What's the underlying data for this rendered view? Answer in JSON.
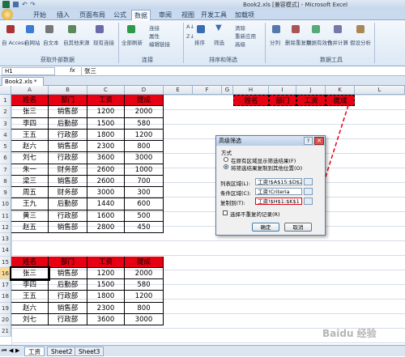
{
  "app": {
    "title": "Book2.xls [兼容模式] - Microsoft Excel"
  },
  "ribbon_tabs": [
    "开始",
    "插入",
    "页面布局",
    "公式",
    "数据",
    "审阅",
    "视图",
    "开发工具",
    "加载项"
  ],
  "ribbon": {
    "get_external": {
      "items": [
        "自 Access",
        "自网站",
        "自文本",
        "自其他来源",
        "现有连接"
      ],
      "group": "获取外部数据"
    },
    "connections": {
      "items": [
        "全部刷新",
        "连接",
        "属性",
        "编辑链接"
      ],
      "group": "连接"
    },
    "sort_filter": {
      "items": [
        "排序",
        "筛选",
        "清除",
        "重新应用",
        "高级"
      ],
      "group": "排序和筛选"
    },
    "data_tools": {
      "items": [
        "分列",
        "删除重复项",
        "数据有效性",
        "合并计算",
        "假设分析"
      ],
      "group": "数据工具"
    }
  },
  "formula_bar": {
    "name_box": "H1",
    "fx": "fx",
    "content": "张三"
  },
  "file_tab": {
    "label": "Book2.xls *"
  },
  "columns": [
    "A",
    "B",
    "C",
    "D",
    "E",
    "F",
    "G",
    "H",
    "I",
    "J",
    "K",
    "L"
  ],
  "rows": [
    "1",
    "2",
    "3",
    "4",
    "5",
    "6",
    "7",
    "8",
    "9",
    "10",
    "11",
    "12",
    "13",
    "14",
    "15",
    "16",
    "17",
    "18",
    "19",
    "20",
    "21"
  ],
  "table1": {
    "headers": [
      "姓名",
      "部门",
      "工资",
      "提成"
    ],
    "rows": [
      [
        "张三",
        "销售部",
        "1200",
        "2000"
      ],
      [
        "李四",
        "后勤部",
        "1500",
        "580"
      ],
      [
        "王五",
        "行政部",
        "1800",
        "1200"
      ],
      [
        "赵六",
        "销售部",
        "2300",
        "800"
      ],
      [
        "刘七",
        "行政部",
        "3600",
        "3000"
      ],
      [
        "朱一",
        "财务部",
        "2600",
        "1000"
      ],
      [
        "梁三",
        "销售部",
        "2600",
        "700"
      ],
      [
        "周五",
        "财务部",
        "3000",
        "300"
      ],
      [
        "王九",
        "后勤部",
        "1440",
        "600"
      ],
      [
        "黄三",
        "行政部",
        "1600",
        "500"
      ],
      [
        "赵五",
        "销售部",
        "2800",
        "450"
      ]
    ]
  },
  "criteria_headers": [
    "姓名",
    "部门",
    "工资",
    "提成"
  ],
  "table2": {
    "headers": [
      "姓名",
      "部门",
      "工资",
      "提成"
    ],
    "rows": [
      [
        "张三",
        "销售部",
        "1200",
        "2000"
      ],
      [
        "李四",
        "后勤部",
        "1500",
        "580"
      ],
      [
        "王五",
        "行政部",
        "1800",
        "1200"
      ],
      [
        "赵六",
        "销售部",
        "2300",
        "800"
      ],
      [
        "刘七",
        "行政部",
        "3600",
        "3000"
      ]
    ]
  },
  "dialog": {
    "title": "高级筛选",
    "method_label": "方式",
    "opt1": "在原有区域显示筛选结果(F)",
    "opt2": "将筛选结果复制到其他位置(O)",
    "list_label": "列表区域(L):",
    "list_value": "工资!$A$15:$D$20",
    "criteria_label": "条件区域(C):",
    "criteria_value": "工资!Criteria",
    "copy_label": "复制到(T):",
    "copy_value": "工资!$H$1:$K$1",
    "unique_label": "选择不重复的记录(R)",
    "ok": "确定",
    "cancel": "取消"
  },
  "sheets": [
    "工资",
    "Sheet2",
    "Sheet3"
  ],
  "watermark": "Baidu 经验",
  "colors": {
    "header_red": "#e60012",
    "arrow_red": "#e60012"
  }
}
